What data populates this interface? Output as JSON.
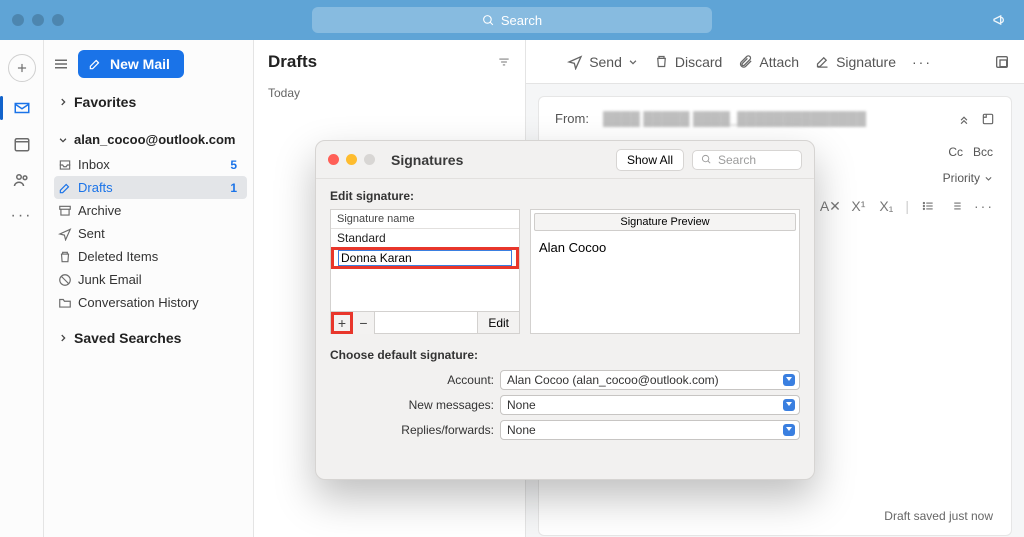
{
  "titlebar": {
    "search_placeholder": "Search"
  },
  "newmail_label": "New Mail",
  "sections": {
    "favorites": "Favorites",
    "saved_searches": "Saved Searches"
  },
  "account": {
    "email": "alan_cocoo@outlook.com"
  },
  "folders": {
    "inbox": {
      "label": "Inbox",
      "count": "5"
    },
    "drafts": {
      "label": "Drafts",
      "count": "1"
    },
    "archive": {
      "label": "Archive"
    },
    "sent": {
      "label": "Sent"
    },
    "deleted": {
      "label": "Deleted Items"
    },
    "junk": {
      "label": "Junk Email"
    },
    "conversation": {
      "label": "Conversation History"
    }
  },
  "listpane": {
    "title": "Drafts",
    "subhead": "Today"
  },
  "compose": {
    "send": "Send",
    "discard": "Discard",
    "attach": "Attach",
    "signature": "Signature",
    "from_label": "From:",
    "cc": "Cc",
    "bcc": "Bcc",
    "priority": "Priority",
    "draft_saved": "Draft saved just now"
  },
  "modal": {
    "title": "Signatures",
    "show_all": "Show All",
    "search_placeholder": "Search",
    "edit_label": "Edit signature:",
    "col_sig_name": "Signature name",
    "sig_standard": "Standard",
    "sig_editing_value": "Donna Karan",
    "edit_btn": "Edit",
    "preview_header": "Signature Preview",
    "preview_value": "Alan Cocoo",
    "choose_label": "Choose default signature:",
    "account_label": "Account:",
    "account_value": "Alan Cocoo (alan_cocoo@outlook.com)",
    "newmsg_label": "New messages:",
    "newmsg_value": "None",
    "replies_label": "Replies/forwards:",
    "replies_value": "None"
  }
}
